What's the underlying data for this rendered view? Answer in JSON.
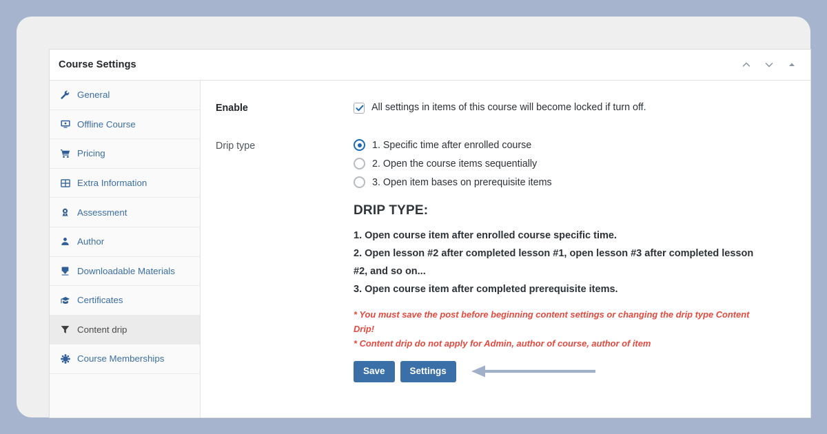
{
  "window": {
    "title": "Course Settings",
    "actions": [
      {
        "name": "collapse-up-icon",
        "icon": "chevron-up"
      },
      {
        "name": "expand-down-icon",
        "icon": "chevron-down"
      },
      {
        "name": "toggle-panel-icon",
        "icon": "triangle-up"
      }
    ]
  },
  "sidebar": {
    "items": [
      {
        "label": "General",
        "icon": "wrench-icon",
        "active": false
      },
      {
        "label": "Offline Course",
        "icon": "monitor-icon",
        "active": false
      },
      {
        "label": "Pricing",
        "icon": "cart-icon",
        "active": false
      },
      {
        "label": "Extra Information",
        "icon": "table-icon",
        "active": false
      },
      {
        "label": "Assessment",
        "icon": "award-icon",
        "active": false
      },
      {
        "label": "Author",
        "icon": "user-icon",
        "active": false
      },
      {
        "label": "Downloadable Materials",
        "icon": "download-icon",
        "active": false
      },
      {
        "label": "Certificates",
        "icon": "graduation-cap-icon",
        "active": false
      },
      {
        "label": "Content drip",
        "icon": "funnel-icon",
        "active": true
      },
      {
        "label": "Course Memberships",
        "icon": "users-group-icon",
        "active": false
      }
    ]
  },
  "main": {
    "enable": {
      "label": "Enable",
      "checked": true,
      "description": "All settings in items of this course will become locked if turn off."
    },
    "drip_type": {
      "label": "Drip type",
      "selected_index": 0,
      "options": [
        "1. Specific time after enrolled course",
        "2. Open the course items sequentially",
        "3. Open item bases on prerequisite items"
      ]
    },
    "description": {
      "title": "DRIP TYPE:",
      "lines": [
        "1. Open course item after enrolled course specific time.",
        "2. Open lesson #2 after completed lesson #1, open lesson #3 after completed lesson #2, and so on...",
        "3. Open course item after completed prerequisite items."
      ]
    },
    "notices": [
      "* You must save the post before beginning content settings or changing the drip type Content Drip!",
      "* Content drip do not apply for Admin, author of course, author of item"
    ],
    "buttons": {
      "save": "Save",
      "settings": "Settings"
    },
    "annotation_arrow": {
      "name": "pointer-arrow",
      "direction": "left",
      "color": "#9fb0c8"
    }
  },
  "colors": {
    "page_background": "#a6b5cd",
    "frame": "#efefef",
    "card": "#ffffff",
    "sidebar": "#fafafa",
    "sidebar_active": "#ebebeb",
    "link": "#3b6ea5",
    "accent_blue": "#3b6fa8",
    "radio_blue": "#1a6bb5",
    "notice_red": "#e04a3f"
  }
}
